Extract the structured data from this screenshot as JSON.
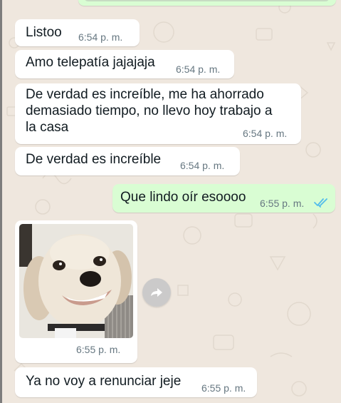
{
  "colors": {
    "background": "#efe7de",
    "incoming_bubble": "#ffffff",
    "outgoing_bubble": "#d9fdd3",
    "time_text": "#667781",
    "read_ticks": "#53bdeb"
  },
  "messages": [
    {
      "direction": "in",
      "text": "Listoo",
      "time": "6:54 p. m."
    },
    {
      "direction": "in",
      "text": "Amo telepatía jajajaja",
      "time": "6:54 p. m."
    },
    {
      "direction": "in",
      "text": "De verdad es increíble, me ha ahorrado\ndemasiado tiempo, no llevo hoy trabajo a\nla casa",
      "time": "6:54 p. m."
    },
    {
      "direction": "in",
      "text": "De verdad es increíble",
      "time": "6:54 p. m."
    },
    {
      "direction": "out",
      "text": "Que lindo oír esoooo",
      "time": "6:55 p. m.",
      "status_icon": "double-check-read-icon"
    },
    {
      "direction": "in",
      "type": "image",
      "image_description_icon": "dog-photo",
      "time": "6:55 p. m.",
      "action_icon": "forward-icon"
    },
    {
      "direction": "in",
      "text": "Ya no voy a renunciar jeje",
      "time": "6:55 p. m."
    }
  ]
}
